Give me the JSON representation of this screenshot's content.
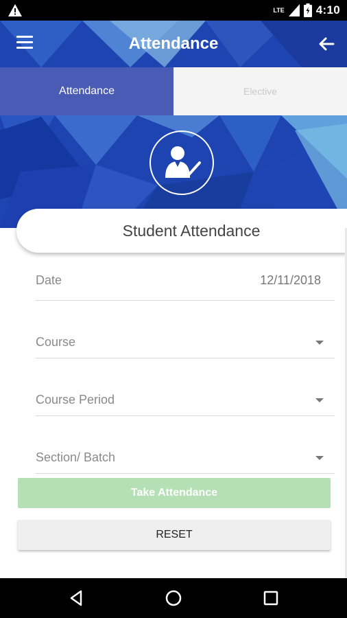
{
  "status_bar": {
    "network": "LTE",
    "time": "4:10"
  },
  "app_bar": {
    "title": "Attendance"
  },
  "tabs": [
    {
      "label": "Attendance",
      "active": true
    },
    {
      "label": "Elective",
      "active": false
    }
  ],
  "card": {
    "title": "Student Attendance"
  },
  "form": {
    "date": {
      "label": "Date",
      "value": "12/11/2018"
    },
    "course": {
      "label": "Course"
    },
    "course_period": {
      "label": "Course Period"
    },
    "section_batch": {
      "label": "Section/ Batch"
    }
  },
  "buttons": {
    "take_attendance": "Take Attendance",
    "reset": "RESET"
  },
  "colors": {
    "primary": "#1a3fa8",
    "tab_active": "#4a5bb5",
    "take_button": "#b5dfb5"
  }
}
